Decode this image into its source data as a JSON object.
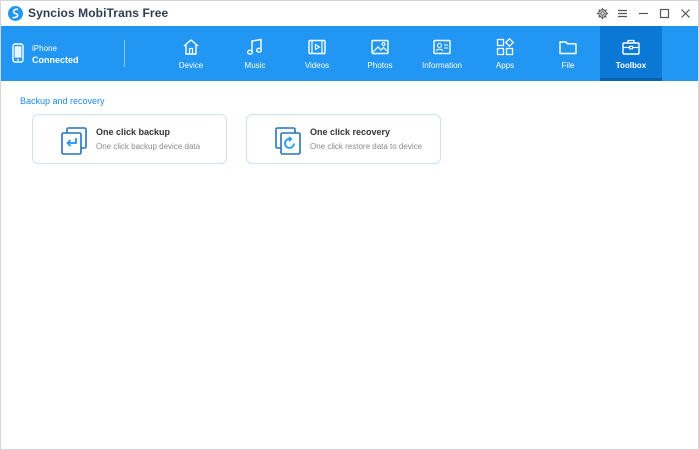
{
  "app": {
    "title": "Syncios MobiTrans Free"
  },
  "window_controls": [
    "gear-icon",
    "menu-icon",
    "minimize-icon",
    "maximize-icon",
    "close-icon"
  ],
  "device": {
    "name": "iPhone",
    "status": "Connected"
  },
  "nav": {
    "items": [
      {
        "label": "Device",
        "icon": "home-icon"
      },
      {
        "label": "Music",
        "icon": "music-note-icon"
      },
      {
        "label": "Videos",
        "icon": "film-icon"
      },
      {
        "label": "Photos",
        "icon": "image-icon"
      },
      {
        "label": "Information",
        "icon": "contact-card-icon"
      },
      {
        "label": "Apps",
        "icon": "apps-grid-icon"
      },
      {
        "label": "File",
        "icon": "folder-icon"
      },
      {
        "label": "Toolbox",
        "icon": "toolbox-icon"
      }
    ],
    "active": "Toolbox"
  },
  "section": {
    "title": "Backup and recovery"
  },
  "cards": [
    {
      "title": "One click backup",
      "subtitle": "One click backup device data",
      "icon": "backup-icon"
    },
    {
      "title": "One click recovery",
      "subtitle": "One click restore data to device",
      "icon": "recovery-icon"
    }
  ],
  "colors": {
    "accent": "#2196f3",
    "active_tab": "#0b78d6",
    "section_title": "#1e88e5",
    "card_border": "#cde2f5"
  }
}
